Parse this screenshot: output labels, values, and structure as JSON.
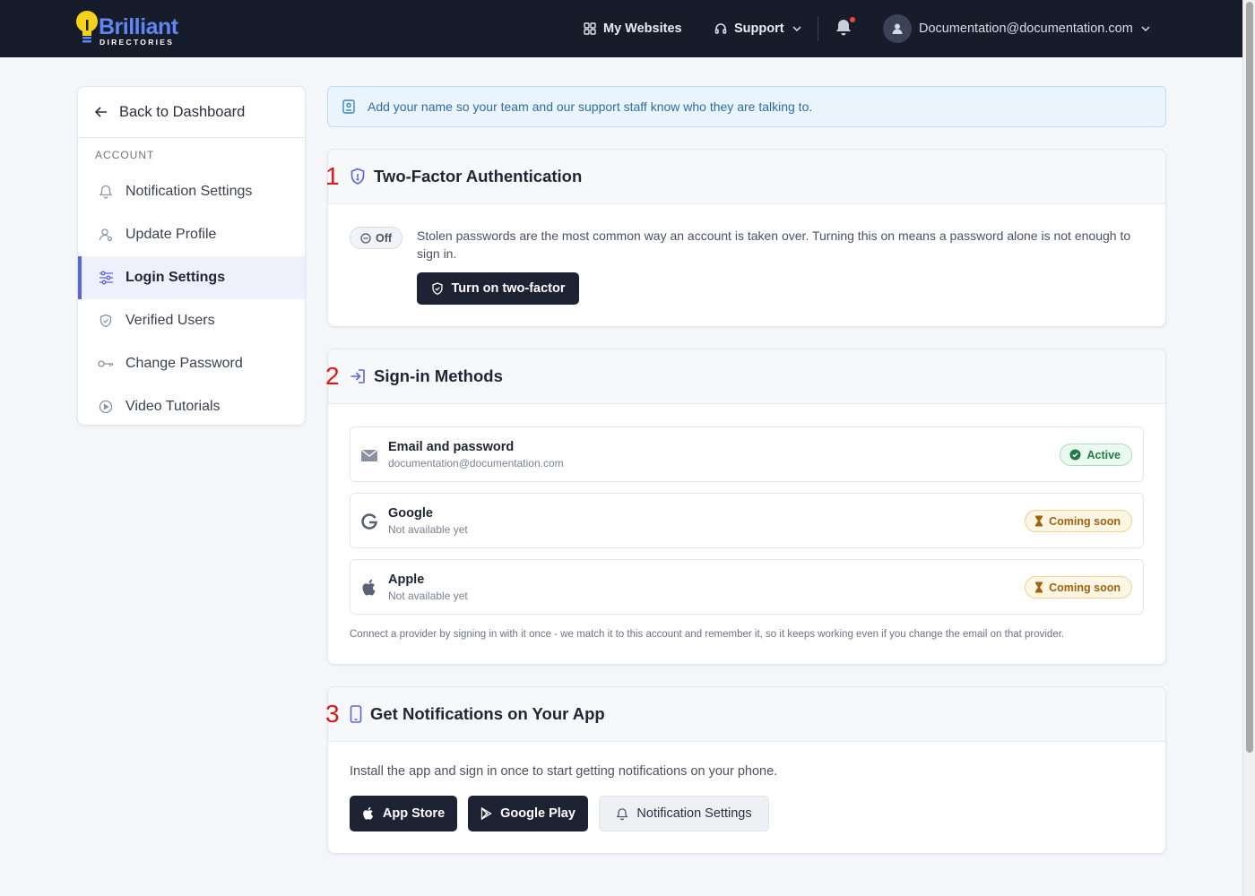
{
  "header": {
    "logo_word": "Brilliant",
    "logo_sub": "DIRECTORIES",
    "my_websites": "My Websites",
    "support": "Support",
    "user_email": "Documentation@documentation.com"
  },
  "sidebar": {
    "back_label": "Back to Dashboard",
    "section_heading": "ACCOUNT",
    "items": [
      {
        "label": "Notification Settings",
        "icon": "bell-icon",
        "active": false
      },
      {
        "label": "Update Profile",
        "icon": "user-icon",
        "active": false
      },
      {
        "label": "Login Settings",
        "icon": "sliders-icon",
        "active": true
      },
      {
        "label": "Verified Users",
        "icon": "shield-check-icon",
        "active": false
      },
      {
        "label": "Change Password",
        "icon": "key-icon",
        "active": false
      },
      {
        "label": "Video Tutorials",
        "icon": "play-circle-icon",
        "active": false
      }
    ]
  },
  "banner": {
    "text": "Add your name so your team and our support staff know who they are talking to."
  },
  "two_factor": {
    "marker": "1",
    "title": "Two-Factor Authentication",
    "status": "Off",
    "description": "Stolen passwords are the most common way an account is taken over. Turning this on means a password alone is not enough to sign in.",
    "button_label": "Turn on two-factor"
  },
  "sign_in": {
    "marker": "2",
    "title": "Sign-in Methods",
    "methods": [
      {
        "name": "Email and password",
        "sub": "documentation@documentation.com",
        "badge": "Active",
        "icon": "mail-icon"
      },
      {
        "name": "Google",
        "sub": "Not available yet",
        "badge": "Coming soon",
        "icon": "google-icon"
      },
      {
        "name": "Apple",
        "sub": "Not available yet",
        "badge": "Coming soon",
        "icon": "apple-icon"
      }
    ],
    "note": "Connect a provider by signing in with it once - we match it to this account and remember it, so it keeps working even if you change the email on that provider."
  },
  "app_notifications": {
    "marker": "3",
    "title": "Get Notifications on Your App",
    "description": "Install the app and sign in once to start getting notifications on your phone.",
    "app_store": "App Store",
    "google_play": "Google Play",
    "notification_settings": "Notification Settings"
  },
  "colors": {
    "topbar": "#171c2b",
    "accent": "#5865e0",
    "marker": "#e01616"
  }
}
